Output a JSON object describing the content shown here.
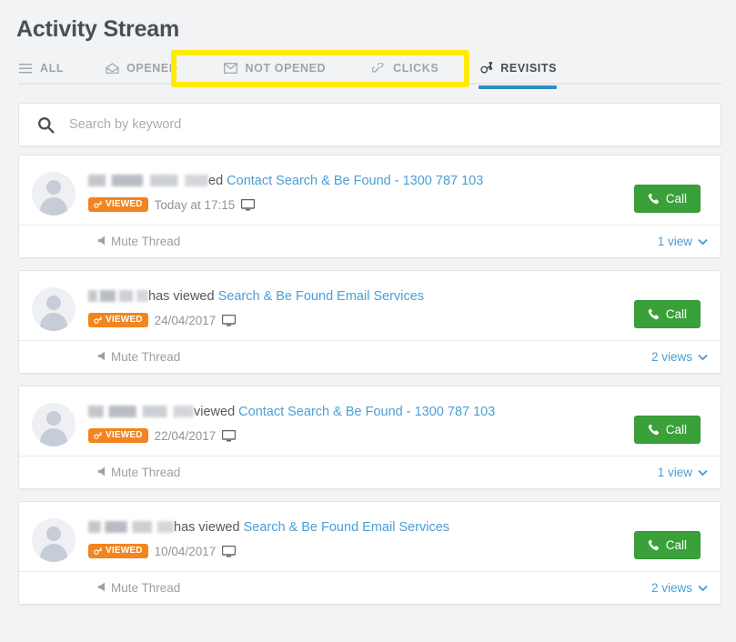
{
  "header": {
    "title": "Activity Stream"
  },
  "tabs": [
    {
      "id": "all",
      "label": "ALL",
      "icon": "hamburger-icon",
      "active": false
    },
    {
      "id": "opened",
      "label": "OPENED",
      "icon": "envelope-open-icon",
      "active": false
    },
    {
      "id": "not-opened",
      "label": "NOT OPENED",
      "icon": "envelope-closed-icon",
      "active": false
    },
    {
      "id": "clicks",
      "label": "CLICKS",
      "icon": "link-chain-icon",
      "active": false
    },
    {
      "id": "revisits",
      "label": "REVISITS",
      "icon": "sprocket-icon",
      "active": true
    }
  ],
  "search": {
    "icon": "search-icon",
    "placeholder": "Search by keyword",
    "value": ""
  },
  "annotation": {
    "color": "#ffeb00",
    "shape": "rectangle-highlight"
  },
  "colors": {
    "accent_blue": "#4a9fd4",
    "active_tab_underline": "#2d8fc4",
    "badge_orange": "#f2851f",
    "call_green": "#3aa03a",
    "page_background": "#f2f3f5",
    "card_background": "#ffffff"
  },
  "cards": [
    {
      "avatar": "default-user-avatar",
      "name": "[redacted]",
      "verb": "ed",
      "subject": "Contact Search & Be Found - 1300 787 103",
      "badge": "VIEWED",
      "when": "Today at 17:15",
      "device": "desktop-monitor-icon",
      "call_label": "Call",
      "mute_label": "Mute Thread",
      "views_label": "1 view"
    },
    {
      "avatar": "default-user-avatar",
      "name": "[redacted]",
      "verb": "has viewed",
      "subject": "Search & Be Found Email Services",
      "badge": "VIEWED",
      "when": "24/04/2017",
      "device": "desktop-monitor-icon",
      "call_label": "Call",
      "mute_label": "Mute Thread",
      "views_label": "2 views"
    },
    {
      "avatar": "default-user-avatar",
      "name": "[redacted]",
      "verb": "viewed",
      "subject": "Contact Search & Be Found - 1300 787 103",
      "badge": "VIEWED",
      "when": "22/04/2017",
      "device": "desktop-monitor-icon",
      "call_label": "Call",
      "mute_label": "Mute Thread",
      "views_label": "1 view"
    },
    {
      "avatar": "default-user-avatar",
      "name": "[redacted]",
      "verb": "has viewed",
      "subject": "Search & Be Found Email Services",
      "badge": "VIEWED",
      "when": "10/04/2017",
      "device": "desktop-monitor-icon",
      "call_label": "Call",
      "mute_label": "Mute Thread",
      "views_label": "2 views"
    }
  ]
}
